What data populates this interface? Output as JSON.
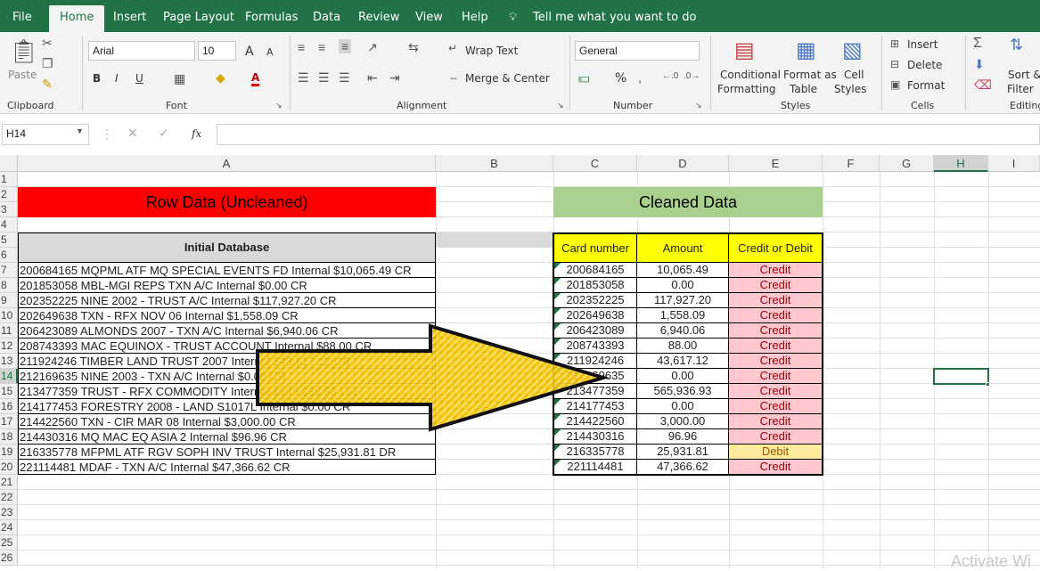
{
  "tabs": [
    "File",
    "Home",
    "Insert",
    "Page Layout",
    "Formulas",
    "Data",
    "Review",
    "View",
    "Help"
  ],
  "tell_me": "Tell me what you want to do",
  "ribbon": {
    "clipboard": {
      "paste": "Paste",
      "group": "Clipboard"
    },
    "font": {
      "name": "Arial",
      "size": "10",
      "bold": "B",
      "italic": "I",
      "underline": "U",
      "grow": "A",
      "shrink": "A",
      "color_a": "A",
      "group": "Font"
    },
    "alignment": {
      "wrap": "Wrap Text",
      "merge": "Merge & Center",
      "group": "Alignment"
    },
    "number": {
      "format": "General",
      "percent": "%",
      "comma": "9",
      "inc": ".0​.00",
      "group": "Number"
    },
    "styles": {
      "cond1": "Conditional",
      "cond2": "Formatting",
      "fat1": "Format as",
      "fat2": "Table",
      "cell1": "Cell",
      "cell2": "Styles",
      "group": "Styles"
    },
    "cells": {
      "insert": "Insert",
      "delete": "Delete",
      "format": "Format",
      "group": "Cells"
    },
    "editing": {
      "sort1": "Sort &",
      "sort2": "Filter",
      "group": "Editing"
    }
  },
  "formula_bar": {
    "name_box": "H14",
    "fx": "fx",
    "value": ""
  },
  "columns": [
    "A",
    "B",
    "C",
    "D",
    "E",
    "F",
    "G",
    "H",
    "I"
  ],
  "rows": [
    "1",
    "2",
    "3",
    "4",
    "5",
    "6",
    "7",
    "8",
    "9",
    "10",
    "11",
    "12",
    "13",
    "14",
    "15",
    "16",
    "17",
    "18",
    "19",
    "20",
    "21",
    "22",
    "23",
    "24",
    "25",
    "26"
  ],
  "raw_title": "Row Data (Uncleaned)",
  "clean_title": "Cleaned Data",
  "initial_header": "Initial Database",
  "raw_rows": [
    "200684165 MQPML ATF MQ SPECIAL EVENTS FD  Internal $10,065.49 CR",
    "  201853058 MBL-MGI REPS TXN A/C  Internal $0.00 CR",
    "  202352225 NINE 2002 - TRUST A/C  Internal $117,927.20 CR",
    "  202649638 TXN - RFX NOV 06  Internal $1,558.09 CR",
    "  206423089 ALMONDS 2007 - TXN A/C  Internal $6,940.06 CR",
    "  208743393 MAC EQUINOX - TRUST ACCOUNT  Internal $88.00 CR",
    "  211924246 TIMBER LAND TRUST 2007  Internal $43,617.12 CR",
    "  212169635 NINE 2003 - TXN A/C  Internal $0.00 CR",
    "  213477359 TRUST - RFX COMMODITY  Internal $565,936.93 CR",
    " 214177453 FORESTRY 2008 - LAND S1017L  Internal $0.00 CR",
    "  214422560 TXN - CIR MAR 08  Internal $3,000.00 CR",
    "  214430316 MQ MAC EQ ASIA 2  Internal $96.96 CR",
    "  216335778 MFPML ATF RGV SOPH INV TRUST  Internal $25,931.81 DR",
    " 221114481 MDAF - TXN A/C  Internal $47,366.62 CR"
  ],
  "clean_headers": [
    "Card number",
    "Amount",
    "Credit or Debit"
  ],
  "clean_rows": [
    [
      "200684165",
      "10,065.49",
      "Credit"
    ],
    [
      "201853058",
      "0.00",
      "Credit"
    ],
    [
      "202352225",
      "117,927.20",
      "Credit"
    ],
    [
      "202649638",
      "1,558.09",
      "Credit"
    ],
    [
      "206423089",
      "6,940.06",
      "Credit"
    ],
    [
      "208743393",
      "88.00",
      "Credit"
    ],
    [
      "211924246",
      "43,617.12",
      "Credit"
    ],
    [
      "212169635",
      "0.00",
      "Credit"
    ],
    [
      "213477359",
      "565,936.93",
      "Credit"
    ],
    [
      "214177453",
      "0.00",
      "Credit"
    ],
    [
      "214422560",
      "3,000.00",
      "Credit"
    ],
    [
      "214430316",
      "96.96",
      "Credit"
    ],
    [
      "216335778",
      "25,931.81",
      "Debit"
    ],
    [
      "221114481",
      "47,366.62",
      "Credit"
    ]
  ],
  "watermark": "Activate Wi",
  "colors": {
    "excel_green": "#217346",
    "raw_title_bg": "#ff0000",
    "clean_title_bg": "#a9d08e",
    "header_yellow": "#ffff00",
    "credit_bg": "#ffc7ce",
    "credit_fg": "#9c0006",
    "debit_bg": "#ffeb9c",
    "debit_fg": "#9c5700",
    "arrow": "#f5c400"
  }
}
